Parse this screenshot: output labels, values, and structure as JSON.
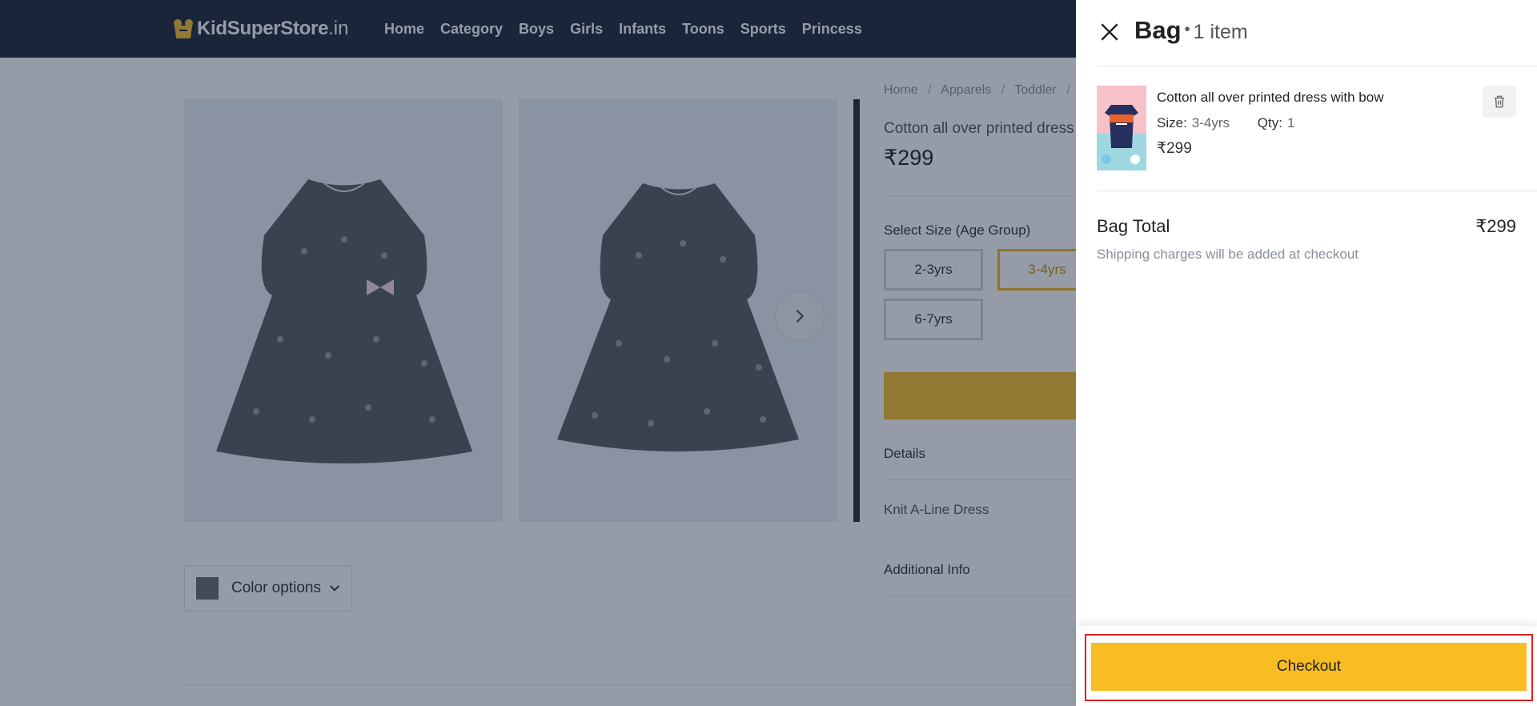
{
  "header": {
    "logo_text": "KidSuperStore",
    "logo_tld": ".in",
    "nav": [
      "Home",
      "Category",
      "Boys",
      "Girls",
      "Infants",
      "Toons",
      "Sports",
      "Princess"
    ]
  },
  "product": {
    "breadcrumb": [
      "Home",
      "Apparels",
      "Toddler"
    ],
    "title": "Cotton all over printed dress",
    "price": "₹299",
    "size_heading": "Select Size (Age Group)",
    "sizes": [
      "2-3yrs",
      "3-4yrs",
      "6-7yrs"
    ],
    "selected_size": "3-4yrs",
    "color_options_label": "Color options",
    "details_heading": "Details",
    "details_value": "Knit A-Line Dress",
    "additional_info_heading": "Additional Info"
  },
  "bag": {
    "title": "Bag",
    "item_count": "1 item",
    "item": {
      "name": "Cotton all over printed dress with bow",
      "size_label": "Size:",
      "size_value": "3-4yrs",
      "qty_label": "Qty:",
      "qty_value": "1",
      "price": "₹299"
    },
    "total_label": "Bag Total",
    "total_value": "₹299",
    "shipping_note": "Shipping charges will be added at checkout",
    "checkout_label": "Checkout"
  },
  "colors": {
    "topbar": "#20273a",
    "accent": "#f7bd22",
    "highlight": "#e02020"
  }
}
